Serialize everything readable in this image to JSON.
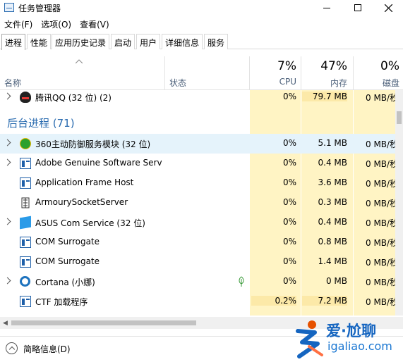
{
  "window": {
    "title": "任务管理器",
    "minimize_icon": "minimize-icon",
    "maximize_icon": "maximize-icon",
    "close_icon": "close-icon"
  },
  "menu": [
    "文件(F)",
    "选项(O)",
    "查看(V)"
  ],
  "tabs": [
    "进程",
    "性能",
    "应用历史记录",
    "启动",
    "用户",
    "详细信息",
    "服务"
  ],
  "active_tab": "进程",
  "columns": {
    "name": "名称",
    "status": "状态",
    "cpu": {
      "percent": "7%",
      "label": "CPU"
    },
    "memory": {
      "percent": "47%",
      "label": "内存"
    },
    "disk": {
      "percent": "0%",
      "label": "磁盘"
    }
  },
  "rows_top": [
    {
      "name": "腾讯QQ (32 位) (2)",
      "cpu": "0%",
      "mem": "79.7 MB",
      "disk": "0 MB/秒",
      "icon": "qq-icon",
      "expandable": true
    }
  ],
  "group": {
    "title": "后台进程 (71)"
  },
  "rows": [
    {
      "name": "360主动防御服务模块 (32 位)",
      "cpu": "0%",
      "mem": "5.1 MB",
      "disk": "0 MB/秒",
      "icon": "shield-icon",
      "expandable": true,
      "highlight": true
    },
    {
      "name": "Adobe Genuine Software Service",
      "cpu": "0%",
      "mem": "0.4 MB",
      "disk": "0 MB/秒",
      "icon": "window-icon",
      "expandable": true
    },
    {
      "name": "Application Frame Host",
      "cpu": "0%",
      "mem": "3.6 MB",
      "disk": "0 MB/秒",
      "icon": "window-icon",
      "expandable": false
    },
    {
      "name": "ArmourySocketServer",
      "cpu": "0%",
      "mem": "0.3 MB",
      "disk": "0 MB/秒",
      "icon": "server-icon",
      "expandable": false
    },
    {
      "name": "ASUS Com Service (32 位)",
      "cpu": "0%",
      "mem": "0.4 MB",
      "disk": "0 MB/秒",
      "icon": "cube-icon",
      "expandable": true
    },
    {
      "name": "COM Surrogate",
      "cpu": "0%",
      "mem": "0.8 MB",
      "disk": "0 MB/秒",
      "icon": "window-icon",
      "expandable": false
    },
    {
      "name": "COM Surrogate",
      "cpu": "0%",
      "mem": "1.4 MB",
      "disk": "0 MB/秒",
      "icon": "window-icon",
      "expandable": false
    },
    {
      "name": "Cortana (小娜)",
      "cpu": "0%",
      "mem": "0 MB",
      "disk": "0 MB/秒",
      "icon": "cortana-icon",
      "expandable": true,
      "status_icon": "leaf-icon"
    },
    {
      "name": "CTF 加载程序",
      "cpu": "0.2%",
      "mem": "7.2 MB",
      "disk": "0 MB/秒",
      "icon": "window-icon",
      "expandable": false
    }
  ],
  "footer": {
    "label": "简略信息(D)"
  },
  "watermark": {
    "cn": "爱·尬聊",
    "en": "igaliao.com"
  },
  "colors": {
    "group_title": "#2b6cb0",
    "cpu_bg": "#fff4c4",
    "mem_bg": "#fce9a8",
    "row_highlight": "#e5f3fb"
  }
}
